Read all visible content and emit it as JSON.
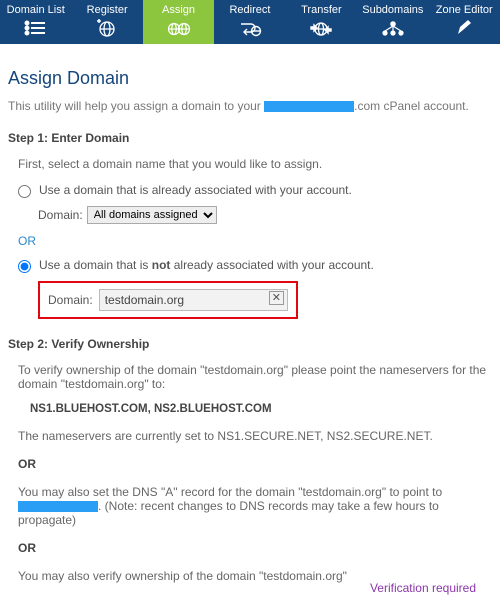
{
  "nav": {
    "items": [
      {
        "label": "Domain List"
      },
      {
        "label": "Register"
      },
      {
        "label": "Assign"
      },
      {
        "label": "Redirect"
      },
      {
        "label": "Transfer"
      },
      {
        "label": "Subdomains"
      },
      {
        "label": "Zone Editor"
      }
    ],
    "active_index": 2
  },
  "page": {
    "title": "Assign Domain",
    "intro_before": "This utility will help you assign a domain to your ",
    "intro_after": ".com cPanel account."
  },
  "step1": {
    "heading": "Step 1: Enter Domain",
    "prompt": "First, select a domain name that you would like to assign.",
    "optA_label": "Use a domain that is already associated with your account.",
    "domain_label": "Domain:",
    "domain_select_text": "All domains assigned",
    "or_text": "OR",
    "optB_before": "Use a domain that is ",
    "optB_bold": "not",
    "optB_after": " already associated with your account.",
    "domain_input_value": "testdomain.org"
  },
  "step2": {
    "heading": "Step 2: Verify Ownership",
    "p1": "To verify ownership of the domain \"testdomain.org\" please point the nameservers for the domain \"testdomain.org\" to:",
    "nameservers": "NS1.BLUEHOST.COM, NS2.BLUEHOST.COM",
    "p2": "The nameservers are currently set to NS1.SECURE.NET, NS2.SECURE.NET.",
    "or": "OR",
    "p3_before": "You may also set the DNS \"A\" record for the domain \"testdomain.org\" to point to ",
    "p3_after": ". (Note: recent changes to DNS records may take a few hours to propagate)",
    "p4": "You may also verify ownership of the domain \"testdomain.org\"",
    "verification": "Verification required"
  }
}
